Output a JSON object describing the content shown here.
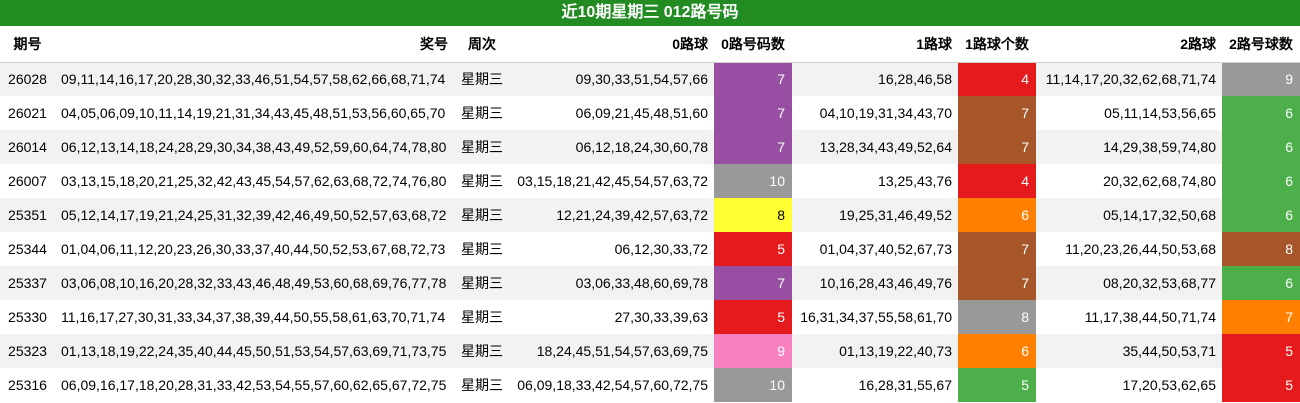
{
  "title": "近10期星期三 012路号码",
  "headers": [
    "期号",
    "奖号",
    "周次",
    "0路球",
    "0路号码数",
    "1路球",
    "1路球个数",
    "2路球",
    "2路号球数"
  ],
  "rows": [
    {
      "issue": "26028",
      "numbers": "09,11,14,16,17,20,28,30,32,33,46,51,54,57,58,62,66,68,71,74",
      "weekday": "星期三",
      "r0": "09,30,33,51,54,57,66",
      "c0": "7",
      "c0_color": "#984ea3",
      "r1": "16,28,46,58",
      "c1": "4",
      "c1_color": "#e41a1c",
      "r2": "11,14,17,20,32,62,68,71,74",
      "c2": "9",
      "c2_color": "#999999"
    },
    {
      "issue": "26021",
      "numbers": "04,05,06,09,10,11,14,19,21,31,34,43,45,48,51,53,56,60,65,70",
      "weekday": "星期三",
      "r0": "06,09,21,45,48,51,60",
      "c0": "7",
      "c0_color": "#984ea3",
      "r1": "04,10,19,31,34,43,70",
      "c1": "7",
      "c1_color": "#a65628",
      "r2": "05,11,14,53,56,65",
      "c2": "6",
      "c2_color": "#4daf4a"
    },
    {
      "issue": "26014",
      "numbers": "06,12,13,14,18,24,28,29,30,34,38,43,49,52,59,60,64,74,78,80",
      "weekday": "星期三",
      "r0": "06,12,18,24,30,60,78",
      "c0": "7",
      "c0_color": "#984ea3",
      "r1": "13,28,34,43,49,52,64",
      "c1": "7",
      "c1_color": "#a65628",
      "r2": "14,29,38,59,74,80",
      "c2": "6",
      "c2_color": "#4daf4a"
    },
    {
      "issue": "26007",
      "numbers": "03,13,15,18,20,21,25,32,42,43,45,54,57,62,63,68,72,74,76,80",
      "weekday": "星期三",
      "r0": "03,15,18,21,42,45,54,57,63,72",
      "c0": "10",
      "c0_color": "#999999",
      "r1": "13,25,43,76",
      "c1": "4",
      "c1_color": "#e41a1c",
      "r2": "20,32,62,68,74,80",
      "c2": "6",
      "c2_color": "#4daf4a"
    },
    {
      "issue": "25351",
      "numbers": "05,12,14,17,19,21,24,25,31,32,39,42,46,49,50,52,57,63,68,72",
      "weekday": "星期三",
      "r0": "12,21,24,39,42,57,63,72",
      "c0": "8",
      "c0_color": "#ffff33",
      "c0_dark": true,
      "r1": "19,25,31,46,49,52",
      "c1": "6",
      "c1_color": "#ff7f00",
      "r2": "05,14,17,32,50,68",
      "c2": "6",
      "c2_color": "#4daf4a"
    },
    {
      "issue": "25344",
      "numbers": "01,04,06,11,12,20,23,26,30,33,37,40,44,50,52,53,67,68,72,73",
      "weekday": "星期三",
      "r0": "06,12,30,33,72",
      "c0": "5",
      "c0_color": "#e41a1c",
      "r1": "01,04,37,40,52,67,73",
      "c1": "7",
      "c1_color": "#a65628",
      "r2": "11,20,23,26,44,50,53,68",
      "c2": "8",
      "c2_color": "#a65628"
    },
    {
      "issue": "25337",
      "numbers": "03,06,08,10,16,20,28,32,33,43,46,48,49,53,60,68,69,76,77,78",
      "weekday": "星期三",
      "r0": "03,06,33,48,60,69,78",
      "c0": "7",
      "c0_color": "#984ea3",
      "r1": "10,16,28,43,46,49,76",
      "c1": "7",
      "c1_color": "#a65628",
      "r2": "08,20,32,53,68,77",
      "c2": "6",
      "c2_color": "#4daf4a"
    },
    {
      "issue": "25330",
      "numbers": "11,16,17,27,30,31,33,34,37,38,39,44,50,55,58,61,63,70,71,74",
      "weekday": "星期三",
      "r0": "27,30,33,39,63",
      "c0": "5",
      "c0_color": "#e41a1c",
      "r1": "16,31,34,37,55,58,61,70",
      "c1": "8",
      "c1_color": "#999999",
      "r2": "11,17,38,44,50,71,74",
      "c2": "7",
      "c2_color": "#ff7f00"
    },
    {
      "issue": "25323",
      "numbers": "01,13,18,19,22,24,35,40,44,45,50,51,53,54,57,63,69,71,73,75",
      "weekday": "星期三",
      "r0": "18,24,45,51,54,57,63,69,75",
      "c0": "9",
      "c0_color": "#f781bf",
      "r1": "01,13,19,22,40,73",
      "c1": "6",
      "c1_color": "#ff7f00",
      "r2": "35,44,50,53,71",
      "c2": "5",
      "c2_color": "#e41a1c"
    },
    {
      "issue": "25316",
      "numbers": "06,09,16,17,18,20,28,31,33,42,53,54,55,57,60,62,65,67,72,75",
      "weekday": "星期三",
      "r0": "06,09,18,33,42,54,57,60,72,75",
      "c0": "10",
      "c0_color": "#999999",
      "r1": "16,28,31,55,67",
      "c1": "5",
      "c1_color": "#4daf4a",
      "r2": "17,20,53,62,65",
      "c2": "5",
      "c2_color": "#e41a1c"
    }
  ]
}
